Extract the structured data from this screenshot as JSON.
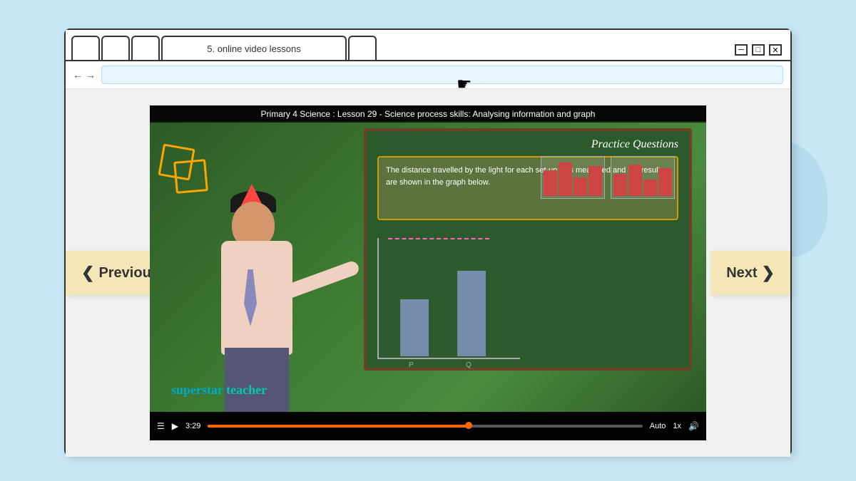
{
  "page": {
    "background_color": "#c8e6f5"
  },
  "browser": {
    "tabs": [
      {
        "label": "",
        "active": false
      },
      {
        "label": "",
        "active": false
      },
      {
        "label": "",
        "active": false
      },
      {
        "label": "5. online video lessons",
        "active": true
      },
      {
        "label": "",
        "active": false
      }
    ],
    "window_controls": {
      "minimize": "─",
      "maximize": "□",
      "close": "✕"
    }
  },
  "navigation": {
    "previous_label": "Previous",
    "next_label": "Next",
    "prev_arrow": "❮",
    "next_arrow": "❯"
  },
  "video": {
    "title": "Primary 4 Science : Lesson 29 - Science process skills: Analysing information and graph",
    "timestamp": "3:29",
    "speed": "1x",
    "quality": "Auto",
    "practice_title": "Practice Questions",
    "practice_text": "The distance travelled by the light for each set-up was measured and the results are shown in the graph below.",
    "watermark_part1": "superstar",
    "watermark_part2": "teacher"
  }
}
